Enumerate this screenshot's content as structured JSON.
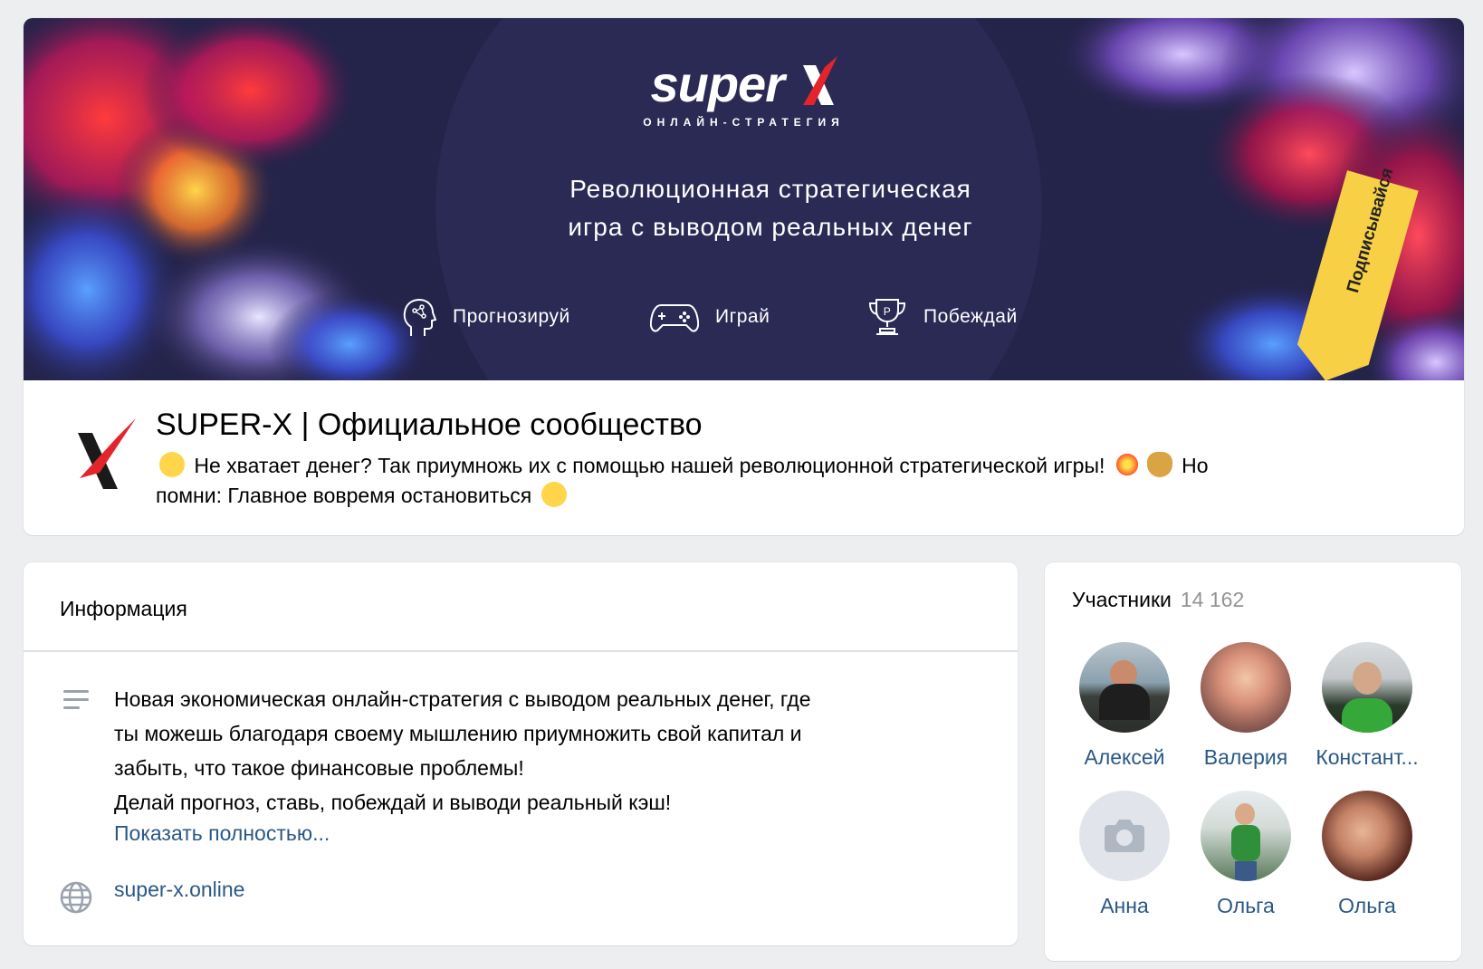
{
  "cover": {
    "logo_text": "super",
    "logo_sub": "ОНЛАЙН-СТРАТЕГИЯ",
    "tagline_line1": "Революционная стратегическая",
    "tagline_line2": "игра с выводом реальных денег",
    "features": [
      {
        "label": "Прогнозируй",
        "icon": "brain-icon"
      },
      {
        "label": "Играй",
        "icon": "gamepad-icon"
      },
      {
        "label": "Побеждай",
        "icon": "trophy-icon"
      }
    ],
    "ribbon_label": "Подписывайся",
    "colors": {
      "background": "#24234a",
      "ribbon": "#f7d046",
      "accent_red": "#e3242b"
    }
  },
  "group": {
    "title": "SUPER-X | Официальное сообщество",
    "status_part1": "Не хватает денег? Так приумножь их с помощью нашей революционной стратегической игры!",
    "status_part2": "Но",
    "status_part3": "помни: Главное вовремя остановиться"
  },
  "info": {
    "title": "Информация",
    "description_line1": "Новая экономическая онлайн-стратегия с выводом реальных денег, где",
    "description_line2": "ты можешь благодаря своему мышлению приумножить свой капитал и",
    "description_line3": "забыть, что такое финансовые проблемы!",
    "description_line4": "Делай прогноз, ставь, побеждай и выводи реальный кэш!",
    "show_more": "Показать полностью...",
    "website": "super-x.online"
  },
  "members": {
    "title": "Участники",
    "count": "14 162",
    "list": [
      {
        "name": "Алексей"
      },
      {
        "name": "Валерия"
      },
      {
        "name": "Констант..."
      },
      {
        "name": "Анна"
      },
      {
        "name": "Ольга"
      },
      {
        "name": "Ольга"
      }
    ]
  },
  "colors": {
    "link": "#2a5885",
    "page_bg": "#edeef0",
    "card_bg": "#ffffff"
  }
}
